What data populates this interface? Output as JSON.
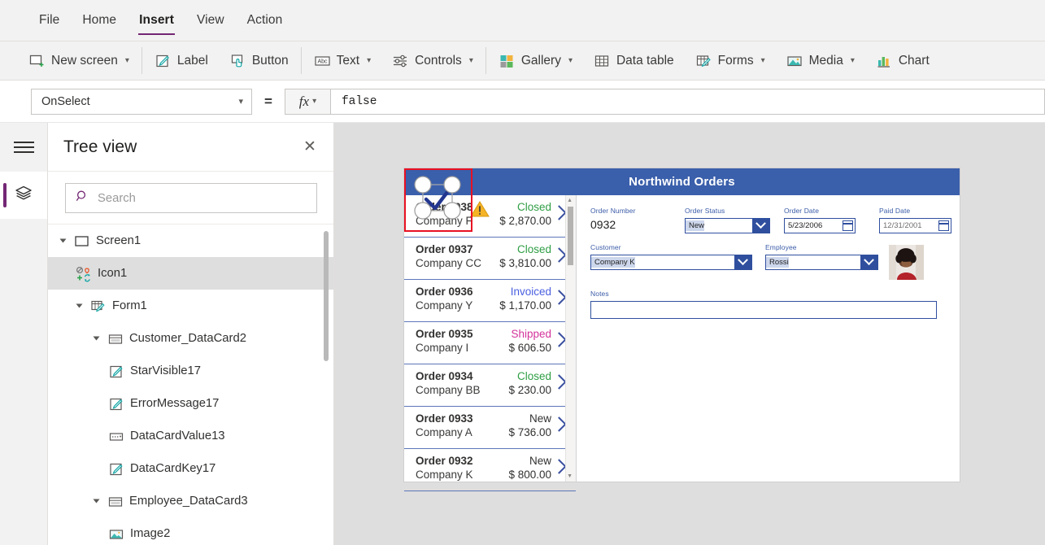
{
  "menu": {
    "items": [
      {
        "label": "File",
        "active": false
      },
      {
        "label": "Home",
        "active": false
      },
      {
        "label": "Insert",
        "active": true
      },
      {
        "label": "View",
        "active": false
      },
      {
        "label": "Action",
        "active": false
      }
    ]
  },
  "ribbon": {
    "items": [
      {
        "label": "New screen",
        "icon": "new-screen-icon",
        "caret": true
      },
      {
        "label": "Label",
        "icon": "label-icon",
        "caret": false
      },
      {
        "label": "Button",
        "icon": "button-icon",
        "caret": false
      },
      {
        "label": "Text",
        "icon": "text-icon",
        "caret": true
      },
      {
        "label": "Controls",
        "icon": "controls-icon",
        "caret": true
      },
      {
        "label": "Gallery",
        "icon": "gallery-icon",
        "caret": true
      },
      {
        "label": "Data table",
        "icon": "data-table-icon",
        "caret": false
      },
      {
        "label": "Forms",
        "icon": "forms-icon",
        "caret": true
      },
      {
        "label": "Media",
        "icon": "media-icon",
        "caret": true
      },
      {
        "label": "Chart",
        "icon": "chart-icon",
        "caret": false
      }
    ]
  },
  "formula_bar": {
    "property": "OnSelect",
    "equals": "=",
    "fx_label": "fx",
    "value": "false"
  },
  "left_rail": {
    "menu_icon": "hamburger-icon",
    "active_icon": "tree-view-layers-icon",
    "accent_color": "#742774"
  },
  "tree_panel": {
    "title": "Tree view",
    "close_label": "✕",
    "search_placeholder": "Search",
    "search_value": "",
    "nodes": [
      {
        "label": "Screen1",
        "depth": 0,
        "icon": "screen-icon",
        "expander": true,
        "selected": false
      },
      {
        "label": "Icon1",
        "depth": 1,
        "icon": "icons-group-icon",
        "expander": false,
        "selected": true
      },
      {
        "label": "Form1",
        "depth": 1,
        "icon": "edit-form-icon",
        "expander": true,
        "selected": false
      },
      {
        "label": "Customer_DataCard2",
        "depth": 2,
        "icon": "data-card-icon",
        "expander": true,
        "selected": false
      },
      {
        "label": "StarVisible17",
        "depth": 3,
        "icon": "label-edit-icon",
        "expander": false,
        "selected": false
      },
      {
        "label": "ErrorMessage17",
        "depth": 3,
        "icon": "label-edit-icon",
        "expander": false,
        "selected": false
      },
      {
        "label": "DataCardValue13",
        "depth": 3,
        "icon": "dropdown-icon",
        "expander": false,
        "selected": false
      },
      {
        "label": "DataCardKey17",
        "depth": 3,
        "icon": "label-edit-icon",
        "expander": false,
        "selected": false
      },
      {
        "label": "Employee_DataCard3",
        "depth": 2,
        "icon": "data-card-icon",
        "expander": true,
        "selected": false
      },
      {
        "label": "Image2",
        "depth": 3,
        "icon": "image-icon",
        "expander": false,
        "selected": false
      }
    ]
  },
  "app": {
    "header_title": "Northwind Orders",
    "header_bg": "#3a5fab",
    "status_colors": {
      "Closed": "#2f9e44",
      "Invoiced": "#4a5fe0",
      "Shipped": "#d4339b",
      "New": "#323130"
    },
    "gallery": [
      {
        "order": "Order 0938",
        "company": "Company F",
        "status": "Closed",
        "amount": "$ 2,870.00"
      },
      {
        "order": "Order 0937",
        "company": "Company CC",
        "status": "Closed",
        "amount": "$ 3,810.00"
      },
      {
        "order": "Order 0936",
        "company": "Company Y",
        "status": "Invoiced",
        "amount": "$ 1,170.00"
      },
      {
        "order": "Order 0935",
        "company": "Company I",
        "status": "Shipped",
        "amount": "$ 606.50"
      },
      {
        "order": "Order 0934",
        "company": "Company BB",
        "status": "Closed",
        "amount": "$ 230.00"
      },
      {
        "order": "Order 0933",
        "company": "Company A",
        "status": "New",
        "amount": "$ 736.00"
      },
      {
        "order": "Order 0932",
        "company": "Company K",
        "status": "New",
        "amount": "$ 800.00"
      }
    ],
    "form": {
      "order_number": {
        "label": "Order Number",
        "value": "0932"
      },
      "order_status": {
        "label": "Order Status",
        "value": "New"
      },
      "order_date": {
        "label": "Order Date",
        "value": "5/23/2006"
      },
      "paid_date": {
        "label": "Paid Date",
        "value": "12/31/2001"
      },
      "customer": {
        "label": "Customer",
        "value": "Company K"
      },
      "employee": {
        "label": "Employee",
        "value": "Rossi"
      },
      "notes": {
        "label": "Notes",
        "value": ""
      },
      "avatar": {
        "name": "employee-photo"
      }
    }
  },
  "selection": {
    "border_color": "#e81123",
    "handle_count": 4,
    "warning_icon": "warning-triangle-icon",
    "selected_control_icon": "check-icon"
  }
}
